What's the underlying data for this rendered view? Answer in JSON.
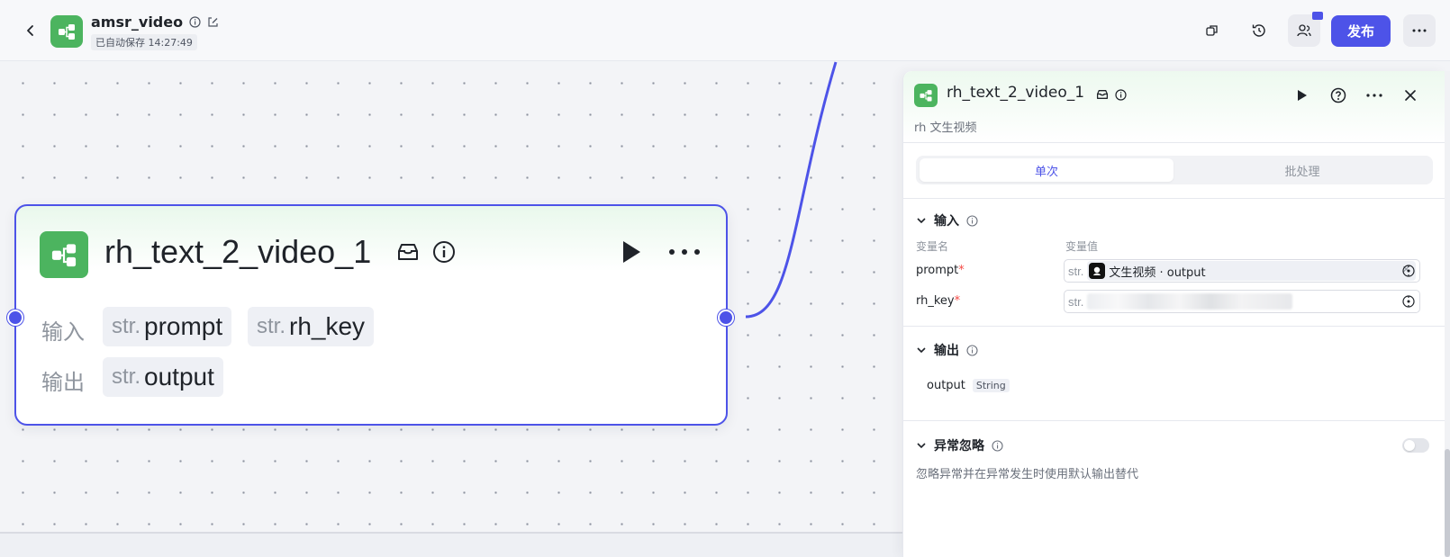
{
  "topbar": {
    "app_name": "amsr_video",
    "autosave_text": "已自动保存 14:27:49",
    "publish_label": "发布",
    "icons": [
      "back-icon",
      "info-icon",
      "edit-icon",
      "duplicate-icon",
      "history-icon",
      "collaborators-icon",
      "more-icon"
    ]
  },
  "node": {
    "title": "rh_text_2_video_1",
    "input_label": "输入",
    "output_label": "输出",
    "inputs": [
      {
        "type": "str.",
        "name": "prompt"
      },
      {
        "type": "str.",
        "name": "rh_key"
      }
    ],
    "outputs": [
      {
        "type": "str.",
        "name": "output"
      }
    ]
  },
  "panel": {
    "title": "rh_text_2_video_1",
    "description": "rh 文生视频",
    "tabs": [
      {
        "label": "单次",
        "active": true
      },
      {
        "label": "批处理",
        "active": false
      }
    ],
    "input_section": {
      "title": "输入",
      "col_name": "变量名",
      "col_value": "变量值",
      "rows": [
        {
          "name": "prompt",
          "required": "*",
          "type": "str.",
          "ref_text": "文生视频 · output"
        },
        {
          "name": "rh_key",
          "required": "*",
          "type": "str.",
          "masked": true
        }
      ]
    },
    "output_section": {
      "title": "输出",
      "items": [
        {
          "name": "output",
          "type": "String"
        }
      ]
    },
    "error_section": {
      "title": "异常忽略",
      "description": "忽略异常并在异常发生时使用默认输出替代",
      "enabled": false
    }
  },
  "colors": {
    "accent": "#4d53e8",
    "node_green": "#4cb45f",
    "required": "#f54a45"
  }
}
